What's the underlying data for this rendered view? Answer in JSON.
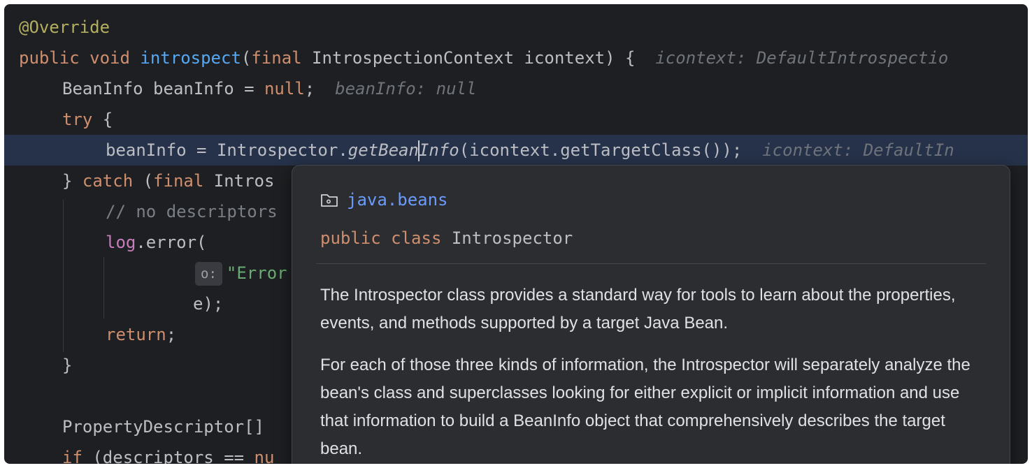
{
  "editor": {
    "l1": {
      "annotation": "@Override"
    },
    "l2": {
      "public": "public",
      "void": "void",
      "method": "introspect",
      "open": "(",
      "final": "final",
      "rest": " IntrospectionContext icontext) {",
      "hint": "icontext: DefaultIntrospectio"
    },
    "l3": {
      "code": "BeanInfo beanInfo = ",
      "null": "null",
      "semi": ";",
      "hint": "beanInfo: null"
    },
    "l4": {
      "try": "try",
      "rest": " {"
    },
    "l5": {
      "code_a": "beanInfo = Introspector.",
      "static_a": "getBean",
      "static_b": "Info",
      "code_b": "(icontext.getTargetClass());",
      "hint": "icontext: DefaultIn"
    },
    "l6": {
      "brace": "} ",
      "catch": "catch",
      "paren": " (",
      "final": "final",
      "rest": " Intros"
    },
    "l7": {
      "comment": "// no descriptors"
    },
    "l8": {
      "field": "log",
      "rest": ".error("
    },
    "l9": {
      "param_hint": "o:",
      "string": "\"Error"
    },
    "l10": {
      "code": "e);"
    },
    "l11": {
      "return": "return",
      "semi": ";"
    },
    "l12": {
      "code": "}"
    },
    "l14": {
      "code": "PropertyDescriptor[]"
    },
    "l15": {
      "if": "if",
      "code": " (descriptors == ",
      "null": "nu"
    }
  },
  "doc_popup": {
    "package": "java.beans",
    "package_icon": "package-folder-icon",
    "sig_public": "public",
    "sig_class": "class",
    "sig_name": "Introspector",
    "paragraph1": "The Introspector class provides a standard way for tools to learn about the properties, events, and methods supported by a target Java Bean.",
    "paragraph2": "For each of those three kinds of information, the Introspector will separately analyze the bean's class and superclasses looking for either explicit or implicit information and use that information to build a BeanInfo object that comprehensively describes the target bean."
  },
  "colors": {
    "background": "#1e1f22",
    "keyword": "#cf8e6d",
    "method": "#56a8f5",
    "annotation": "#b3ae60",
    "string": "#6aab73",
    "field": "#c77dbb",
    "package_link": "#6b9bfa",
    "current_line": "#26324a"
  }
}
